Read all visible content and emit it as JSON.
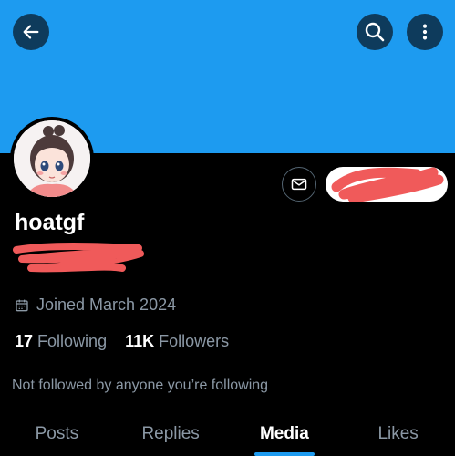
{
  "header": {
    "back_icon": "arrow-left-icon",
    "search_icon": "search-icon",
    "more_icon": "more-vertical-icon",
    "banner_color": "#1d9bf0"
  },
  "profile": {
    "name": "hoatgf",
    "joined": "Joined March 2024",
    "following_count": "17",
    "following_label": "Following",
    "followers_count": "11K",
    "followers_label": "Followers",
    "not_followed_text": "Not followed by anyone you’re following"
  },
  "tabs": [
    {
      "label": "Posts",
      "active": false
    },
    {
      "label": "Replies",
      "active": false
    },
    {
      "label": "Media",
      "active": true
    },
    {
      "label": "Likes",
      "active": false
    }
  ],
  "colors": {
    "accent": "#1d9bf0",
    "redaction": "#f05a5a",
    "muted_text": "#8b98a5"
  }
}
